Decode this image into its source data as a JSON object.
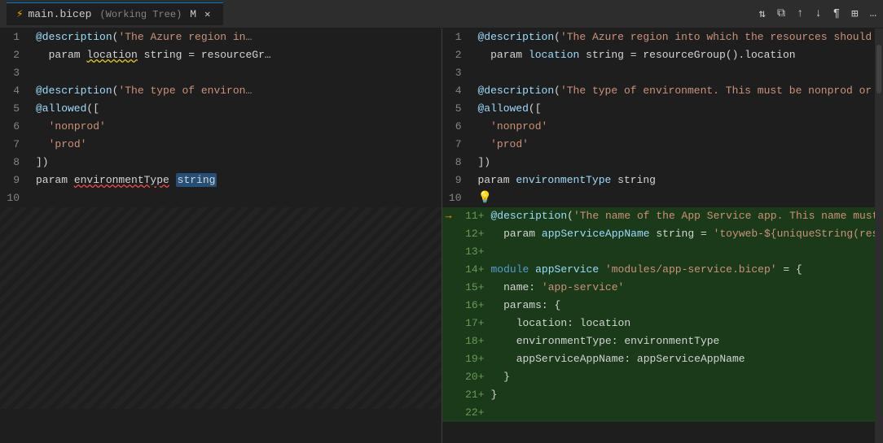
{
  "titleBar": {
    "tab": {
      "icon": "⚡",
      "name": "main.bicep",
      "context": "(Working Tree)",
      "modified": "M",
      "close": "✕"
    },
    "actions": [
      "⇅",
      "⧉",
      "↑",
      "↓",
      "¶",
      "⊞",
      "…"
    ]
  },
  "leftPane": {
    "lines": [
      {
        "num": "1",
        "tokens": [
          {
            "t": "@description",
            "c": "at"
          },
          {
            "t": "(",
            "c": "punct"
          },
          {
            "t": "'The Azure region in",
            "c": "str"
          }
        ]
      },
      {
        "num": "2",
        "tokens": [
          {
            "t": "  param ",
            "c": "plain"
          },
          {
            "t": "location",
            "c": "squiggle-yellow"
          },
          {
            "t": " string = resourceGr",
            "c": "plain"
          }
        ]
      },
      {
        "num": "3",
        "tokens": []
      },
      {
        "num": "4",
        "tokens": [
          {
            "t": "@description",
            "c": "at"
          },
          {
            "t": "(",
            "c": "punct"
          },
          {
            "t": "'The type of environ",
            "c": "str"
          }
        ]
      },
      {
        "num": "5",
        "tokens": [
          {
            "t": "@allowed",
            "c": "at"
          },
          {
            "t": "([",
            "c": "punct"
          }
        ]
      },
      {
        "num": "6",
        "tokens": [
          {
            "t": "  ",
            "c": "plain"
          },
          {
            "t": "'nonprod'",
            "c": "str"
          }
        ]
      },
      {
        "num": "7",
        "tokens": [
          {
            "t": "  ",
            "c": "plain"
          },
          {
            "t": "'prod'",
            "c": "str"
          }
        ]
      },
      {
        "num": "8",
        "tokens": [
          {
            "t": "])",
            "c": "punct"
          }
        ]
      },
      {
        "num": "9",
        "tokens": [
          {
            "t": "param ",
            "c": "plain"
          },
          {
            "t": "environmentType",
            "c": "squiggle-red"
          },
          {
            "t": " ",
            "c": "plain"
          },
          {
            "t": "string",
            "c": "selected"
          }
        ]
      },
      {
        "num": "10",
        "tokens": []
      }
    ]
  },
  "rightPane": {
    "lines": [
      {
        "num": "1",
        "type": "normal",
        "tokens": [
          {
            "t": "@description",
            "c": "at"
          },
          {
            "t": "(",
            "c": "punct"
          },
          {
            "t": "'The Azure region into which the resources should be",
            "c": "str"
          }
        ]
      },
      {
        "num": "2",
        "type": "normal",
        "tokens": [
          {
            "t": "  param ",
            "c": "plain"
          },
          {
            "t": "location",
            "c": "ident"
          },
          {
            "t": " string = resourceGroup().location",
            "c": "plain"
          }
        ]
      },
      {
        "num": "3",
        "type": "normal",
        "tokens": []
      },
      {
        "num": "4",
        "type": "normal",
        "tokens": [
          {
            "t": "@description",
            "c": "at"
          },
          {
            "t": "(",
            "c": "punct"
          },
          {
            "t": "'The type of environment. This must be nonprod or pr",
            "c": "str"
          }
        ]
      },
      {
        "num": "5",
        "type": "normal",
        "tokens": [
          {
            "t": "@allowed",
            "c": "at"
          },
          {
            "t": "([",
            "c": "punct"
          }
        ]
      },
      {
        "num": "6",
        "type": "normal",
        "tokens": [
          {
            "t": "  ",
            "c": "plain"
          },
          {
            "t": "'nonprod'",
            "c": "str"
          }
        ]
      },
      {
        "num": "7",
        "type": "normal",
        "tokens": [
          {
            "t": "  ",
            "c": "plain"
          },
          {
            "t": "'prod'",
            "c": "str"
          }
        ]
      },
      {
        "num": "8",
        "type": "normal",
        "tokens": [
          {
            "t": "])",
            "c": "punct"
          }
        ]
      },
      {
        "num": "9",
        "type": "normal",
        "tokens": [
          {
            "t": "param ",
            "c": "plain"
          },
          {
            "t": "environmentType",
            "c": "ident"
          },
          {
            "t": " string",
            "c": "plain"
          }
        ]
      },
      {
        "num": "10",
        "type": "normal",
        "tokens": [
          {
            "t": "💡",
            "c": "lightbulb"
          }
        ]
      },
      {
        "num": "11",
        "numSuffix": "+",
        "type": "added",
        "arrow": true,
        "tokens": [
          {
            "t": "@description",
            "c": "at"
          },
          {
            "t": "(",
            "c": "punct"
          },
          {
            "t": "'The name of the App Service app. This name must be",
            "c": "str"
          }
        ]
      },
      {
        "num": "12",
        "numSuffix": "+",
        "type": "added",
        "tokens": [
          {
            "t": "  param ",
            "c": "plain"
          },
          {
            "t": "appServiceAppName",
            "c": "ident"
          },
          {
            "t": " string = ",
            "c": "plain"
          },
          {
            "t": "'toyweb-${uniqueString(resourceG",
            "c": "str"
          }
        ]
      },
      {
        "num": "13",
        "numSuffix": "+",
        "type": "added",
        "tokens": []
      },
      {
        "num": "14",
        "numSuffix": "+",
        "type": "added",
        "tokens": [
          {
            "t": "module ",
            "c": "kw"
          },
          {
            "t": "appService",
            "c": "ident"
          },
          {
            "t": " ",
            "c": "plain"
          },
          {
            "t": "'modules/app-service.bicep'",
            "c": "str"
          },
          {
            "t": " = {",
            "c": "plain"
          }
        ]
      },
      {
        "num": "15",
        "numSuffix": "+",
        "type": "added",
        "tokens": [
          {
            "t": "  name: ",
            "c": "plain"
          },
          {
            "t": "'app-service'",
            "c": "str"
          }
        ]
      },
      {
        "num": "16",
        "numSuffix": "+",
        "type": "added",
        "tokens": [
          {
            "t": "  params: {",
            "c": "plain"
          }
        ]
      },
      {
        "num": "17",
        "numSuffix": "+",
        "type": "added",
        "tokens": [
          {
            "t": "    location: location",
            "c": "plain"
          }
        ]
      },
      {
        "num": "18",
        "numSuffix": "+",
        "type": "added",
        "tokens": [
          {
            "t": "    environmentType: environmentType",
            "c": "plain"
          }
        ]
      },
      {
        "num": "19",
        "numSuffix": "+",
        "type": "added",
        "tokens": [
          {
            "t": "    appServiceAppName: appServiceAppName",
            "c": "plain"
          }
        ]
      },
      {
        "num": "20",
        "numSuffix": "+",
        "type": "added",
        "tokens": [
          {
            "t": "  }",
            "c": "plain"
          }
        ]
      },
      {
        "num": "21",
        "numSuffix": "+",
        "type": "added",
        "tokens": [
          {
            "t": "}",
            "c": "plain"
          }
        ]
      },
      {
        "num": "22",
        "numSuffix": "+",
        "type": "added",
        "tokens": []
      }
    ]
  }
}
